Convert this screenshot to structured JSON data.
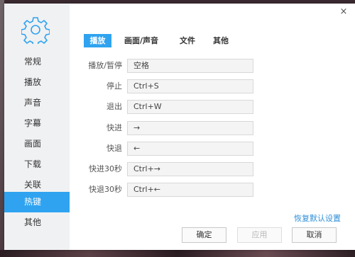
{
  "sidebar": {
    "items": [
      {
        "label": "常规"
      },
      {
        "label": "播放"
      },
      {
        "label": "声音"
      },
      {
        "label": "字幕"
      },
      {
        "label": "画面"
      },
      {
        "label": "下载"
      },
      {
        "label": "关联"
      },
      {
        "label": "热键"
      },
      {
        "label": "其他"
      }
    ],
    "active_index": 7
  },
  "tabs": [
    {
      "label": "播放"
    },
    {
      "label": "画面/声音"
    },
    {
      "label": "文件"
    },
    {
      "label": "其他"
    }
  ],
  "hotkeys": [
    {
      "label": "播放/暂停",
      "value": "空格"
    },
    {
      "label": "停止",
      "value": "Ctrl+S"
    },
    {
      "label": "退出",
      "value": "Ctrl+W"
    },
    {
      "label": "快进",
      "value": "→"
    },
    {
      "label": "快退",
      "value": "←"
    },
    {
      "label": "快进30秒",
      "value": "Ctrl+→"
    },
    {
      "label": "快退30秒",
      "value": "Ctrl+←"
    }
  ],
  "restore_defaults": "恢复默认设置",
  "buttons": {
    "ok": "确定",
    "apply": "应用",
    "cancel": "取消"
  },
  "close_glyph": "×",
  "colors": {
    "accent": "#2fa3f0",
    "link": "#2f8fd8",
    "sidebar_bg": "#f0f1f3"
  },
  "icons": {
    "settings": "gear-icon",
    "close": "close-icon"
  }
}
